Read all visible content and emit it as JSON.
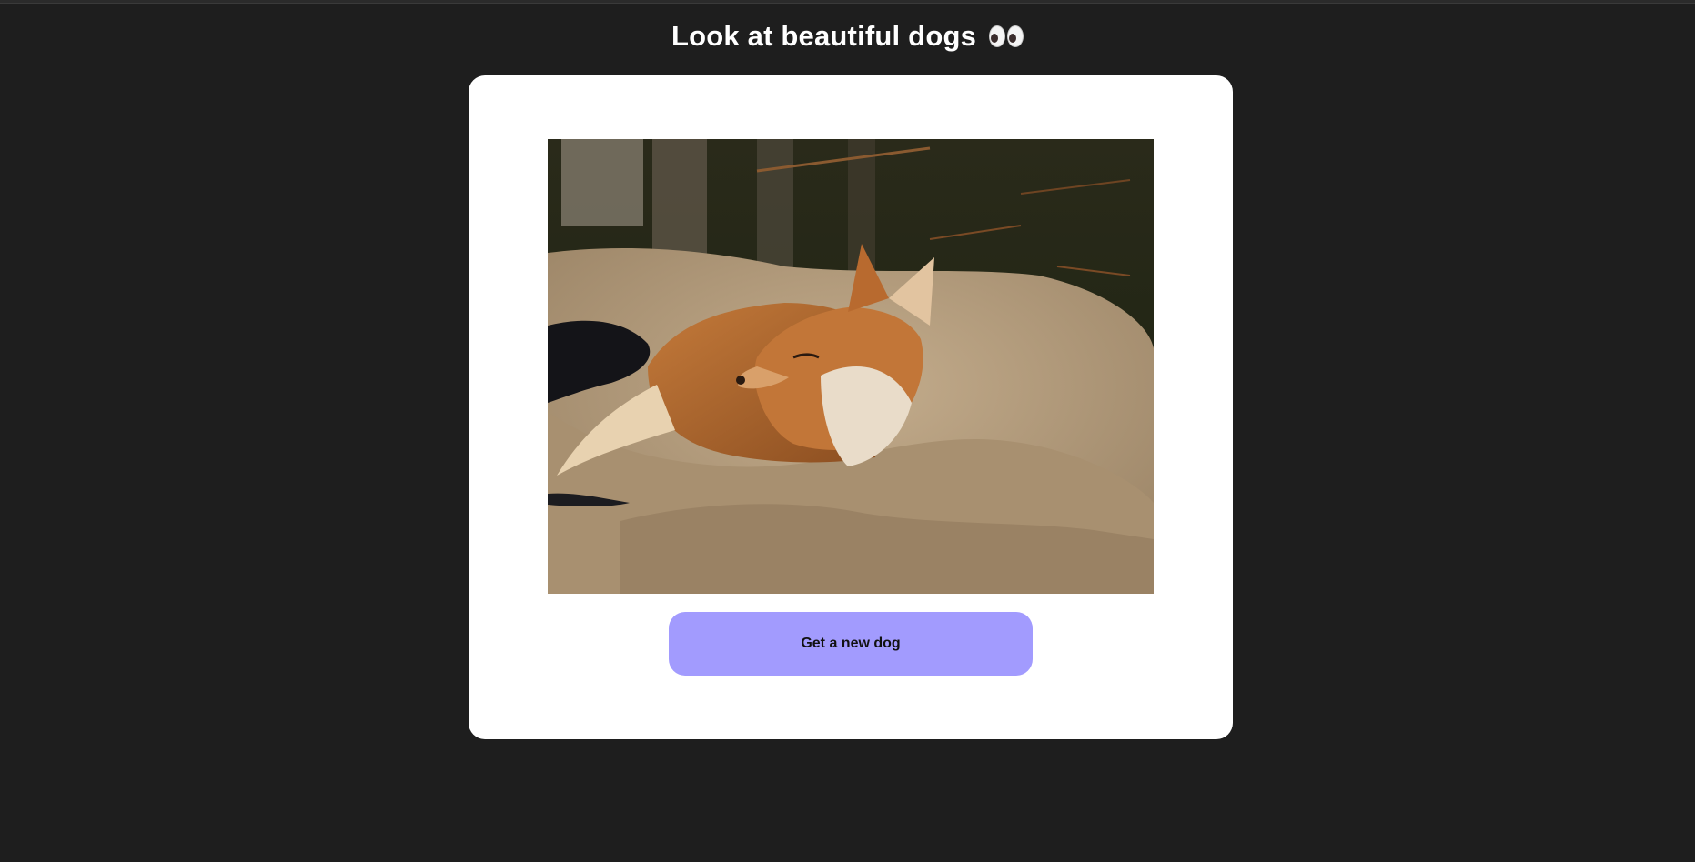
{
  "page": {
    "title": "Look at beautiful dogs",
    "title_emoji": "eyes-icon"
  },
  "card": {
    "image_alt": "dog photo",
    "button_label": "Get a new dog"
  },
  "colors": {
    "background": "#1e1e1e",
    "card": "#ffffff",
    "button": "#a29bfe"
  }
}
